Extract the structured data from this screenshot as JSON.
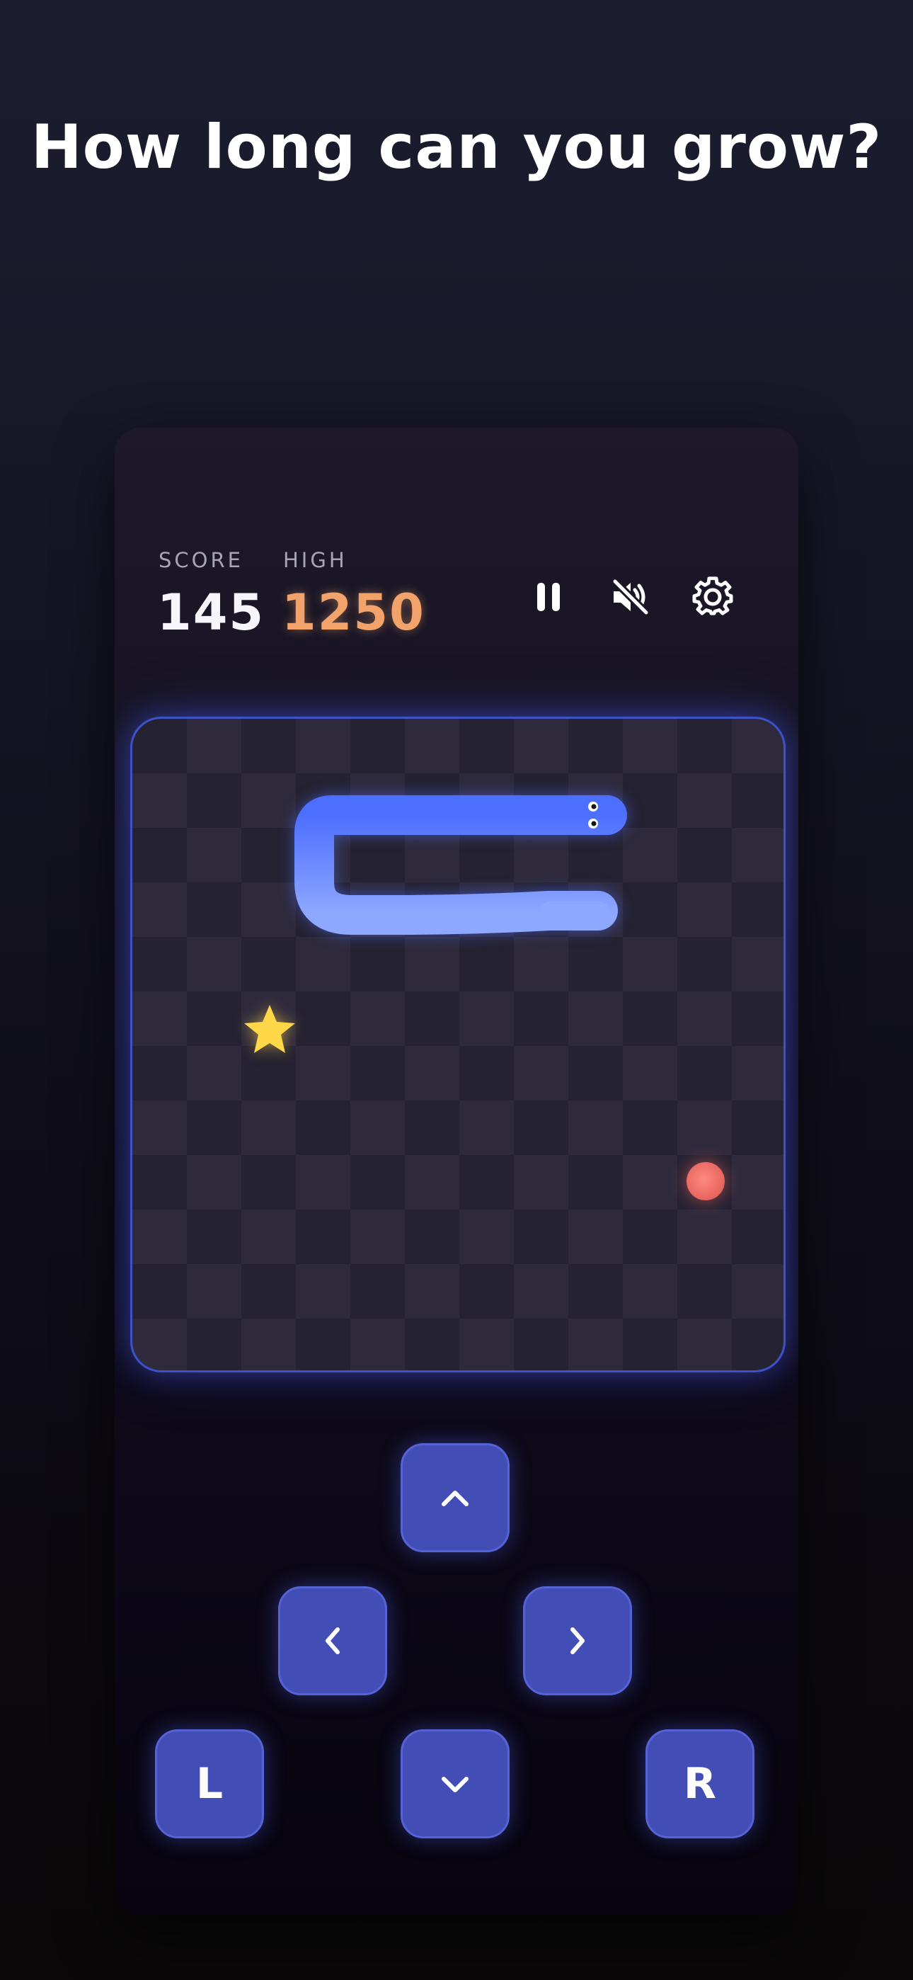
{
  "headline": "How long can you grow?",
  "hud": {
    "score_label": "SCORE",
    "score_value": "145",
    "high_label": "HIGH",
    "high_value": "1250",
    "icons": [
      "pause-icon",
      "mute-icon",
      "gear-icon"
    ]
  },
  "controls": {
    "up_icon": "chevron-up-icon",
    "left_icon": "chevron-left-icon",
    "right_icon": "chevron-right-icon",
    "down_icon": "chevron-down-icon",
    "l_label": "L",
    "r_label": "R"
  },
  "board": {
    "items": [
      "snake",
      "star-pickup",
      "red-food"
    ]
  },
  "colors": {
    "accent": "#434db6",
    "snake": "#4a6bff",
    "high_score": "#f2a36b",
    "food": "#f0706a",
    "star": "#ffd84a"
  }
}
